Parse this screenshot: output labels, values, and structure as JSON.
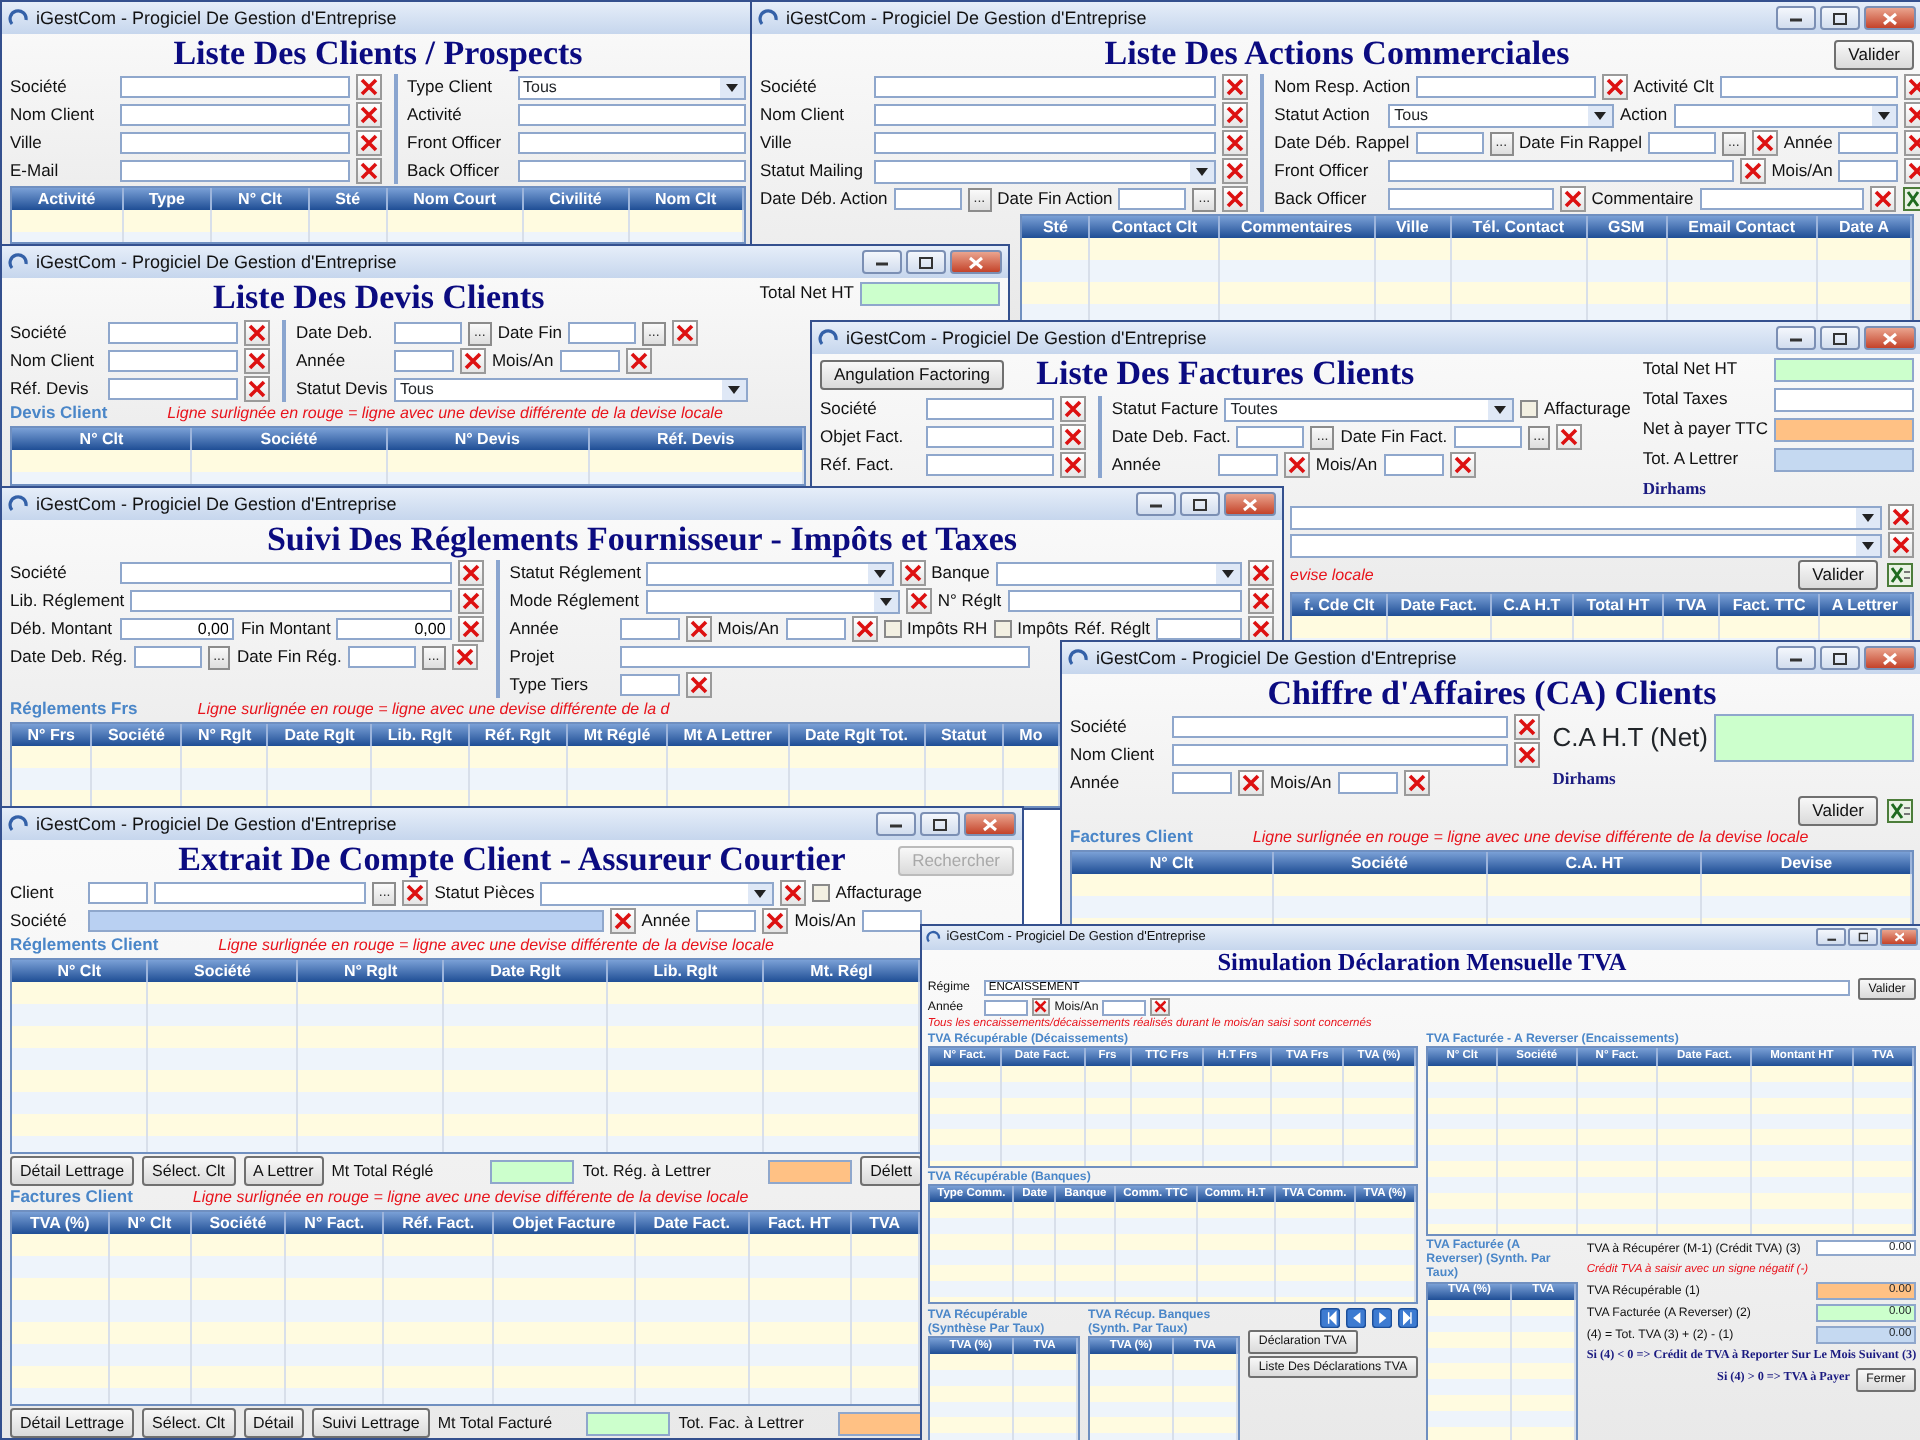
{
  "windows": [
    {
      "title": "iGestCom - Progiciel De Gestion d'Entreprise",
      "sections": [
        {
          "kind": "heading",
          "text": "Liste Des Clients / Prospects"
        },
        {
          "kind": "fields",
          "columns": [
            [
              [
                {
                  "kind": "text",
                  "label": "Société",
                  "clear": true
                }
              ],
              [
                {
                  "kind": "text",
                  "label": "Nom Client",
                  "clear": true
                }
              ],
              [
                {
                  "kind": "text",
                  "label": "Ville",
                  "clear": true
                }
              ],
              [
                {
                  "kind": "text",
                  "label": "E-Mail",
                  "clear": true
                }
              ]
            ],
            [
              [
                {
                  "kind": "combo",
                  "label": "Type Client",
                  "value": "Tous"
                }
              ],
              [
                {
                  "kind": "text",
                  "label": "Activité"
                }
              ],
              [
                {
                  "kind": "text",
                  "label": "Front Officer"
                }
              ],
              [
                {
                  "kind": "text",
                  "label": "Back Officer"
                }
              ]
            ]
          ]
        },
        {
          "kind": "grid",
          "columns": [
            "Activité",
            "Type",
            "N° Clt",
            "Sté",
            "Nom Court",
            "Civilité",
            "Nom Clt"
          ]
        }
      ]
    },
    {
      "title": "iGestCom - Progiciel De Gestion d'Entreprise",
      "sections": [
        {
          "kind": "heading",
          "text": "Liste Des Actions Commerciales",
          "end_button": {
            "kind": "button",
            "label": "Valider"
          }
        },
        {
          "kind": "fields",
          "columns": [
            [
              [
                {
                  "kind": "text",
                  "label": "Société",
                  "clear": true
                }
              ],
              [
                {
                  "kind": "text",
                  "label": "Nom Client",
                  "clear": true
                }
              ],
              [
                {
                  "kind": "text",
                  "label": "Ville",
                  "clear": true
                }
              ],
              [
                {
                  "kind": "combo",
                  "label": "Statut Mailing",
                  "clear": true
                }
              ],
              [
                {
                  "kind": "date",
                  "label": "Date Déb. Action",
                  "picker": "..."
                },
                {
                  "kind": "date",
                  "label": "Date Fin Action",
                  "picker": "...",
                  "clear": true
                }
              ]
            ],
            [
              [
                {
                  "kind": "text",
                  "label": "Nom Resp. Action",
                  "clear": true
                },
                {
                  "kind": "text",
                  "label": "Activité Clt",
                  "clear": true
                }
              ],
              [
                {
                  "kind": "combo",
                  "label": "Statut Action",
                  "value": "Tous"
                },
                {
                  "kind": "combo",
                  "label": "Action",
                  "clear": true
                }
              ],
              [
                {
                  "kind": "date",
                  "label": "Date Déb. Rappel",
                  "picker": "..."
                },
                {
                  "kind": "date",
                  "label": "Date Fin Rappel",
                  "picker": "...",
                  "clear": true
                },
                {
                  "kind": "short",
                  "label": "Année",
                  "clear": true
                }
              ],
              [
                {
                  "kind": "text",
                  "label": "Front Officer",
                  "clear": true
                },
                {
                  "kind": "short",
                  "label": "Mois/An",
                  "clear": true
                }
              ],
              [
                {
                  "kind": "text",
                  "label": "Back Officer",
                  "clear": true
                },
                {
                  "kind": "text",
                  "label": "Commentaire",
                  "clear": true
                },
                {
                  "kind": "export"
                }
              ]
            ]
          ]
        },
        {
          "kind": "grid",
          "columns": [
            "Sté",
            "Contact Clt",
            "Commentaires",
            "Ville",
            "Tél. Contact",
            "GSM",
            "Email Contact",
            "Date A"
          ]
        }
      ]
    },
    {
      "title": "iGestCom - Progiciel De Gestion d'Entreprise",
      "sections": [
        {
          "kind": "split",
          "parts": [
            [
              {
                "kind": "heading",
                "text": "Liste Des Devis Clients"
              },
              {
                "kind": "fields",
                "columns": [
                  [
                    [
                      {
                        "kind": "text",
                        "label": "Société",
                        "clear": true
                      }
                    ],
                    [
                      {
                        "kind": "text",
                        "label": "Nom Client",
                        "clear": true
                      }
                    ],
                    [
                      {
                        "kind": "text",
                        "label": "Réf. Devis",
                        "clear": true
                      }
                    ]
                  ],
                  [
                    [
                      {
                        "kind": "date",
                        "label": "Date Deb.",
                        "picker": "..."
                      },
                      {
                        "kind": "date",
                        "label": "Date Fin",
                        "picker": "...",
                        "clear": true
                      }
                    ],
                    [
                      {
                        "kind": "short",
                        "label": "Année",
                        "clear": true
                      },
                      {
                        "kind": "short",
                        "label": "Mois/An",
                        "clear": true
                      }
                    ],
                    [
                      {
                        "kind": "combo",
                        "label": "Statut Devis",
                        "value": "Tous"
                      }
                    ]
                  ]
                ]
              }
            ],
            [
              {
                "kind": "stack",
                "items": [
                  {
                    "kind": "total",
                    "label": "Total Net HT",
                    "color": "#ccffcc"
                  }
                ]
              }
            ]
          ]
        },
        {
          "kind": "caption",
          "caption": "Devis Client",
          "note": "Ligne surlignée en rouge = ligne avec une devise différente de la devise locale"
        },
        {
          "kind": "grid",
          "columns": [
            "N° Clt",
            "Société",
            "N° Devis",
            "Réf. Devis"
          ]
        }
      ]
    },
    {
      "title": "iGestCom - Progiciel De Gestion d'Entreprise",
      "sections": [
        {
          "kind": "split",
          "parts": [
            [
              {
                "kind": "heading",
                "text": "Liste Des Factures Clients",
                "lead_button": {
                  "kind": "button",
                  "label": "Angulation Factoring"
                }
              },
              {
                "kind": "fields",
                "columns": [
                  [
                    [
                      {
                        "kind": "text",
                        "label": "Société",
                        "clear": true
                      }
                    ],
                    [
                      {
                        "kind": "text",
                        "label": "Objet Fact.",
                        "clear": true
                      }
                    ],
                    [
                      {
                        "kind": "text",
                        "label": "Réf. Fact.",
                        "clear": true
                      }
                    ]
                  ],
                  [
                    [
                      {
                        "kind": "combo",
                        "label": "Statut Facture",
                        "value": "Toutes"
                      },
                      {
                        "kind": "check",
                        "label": "Affacturage",
                        "checked": false
                      }
                    ],
                    [
                      {
                        "kind": "date",
                        "label": "Date Deb. Fact.",
                        "picker": "..."
                      },
                      {
                        "kind": "date",
                        "label": "Date Fin Fact.",
                        "picker": "...",
                        "clear": true
                      }
                    ],
                    [
                      {
                        "kind": "short",
                        "label": "Année",
                        "clear": true
                      },
                      {
                        "kind": "short",
                        "label": "Mois/An",
                        "clear": true
                      }
                    ]
                  ]
                ]
              }
            ],
            [
              {
                "kind": "stack",
                "items": [
                  {
                    "kind": "total",
                    "label": "Total Net HT",
                    "color": "#ccffcc"
                  },
                  {
                    "kind": "total",
                    "label": "Total Taxes",
                    "color": "#ffffff"
                  },
                  {
                    "kind": "total",
                    "label": "Net à payer TTC",
                    "color": "#ffc184"
                  },
                  {
                    "kind": "total",
                    "label": "Tot. A Lettrer",
                    "color": "#c5d9f1"
                  },
                  {
                    "kind": "strong",
                    "text": "Dirhams"
                  }
                ]
              }
            ]
          ]
        },
        {
          "kind": "fields",
          "columns": [
            [
              [
                {
                  "kind": "combo",
                  "clear": true
                }
              ],
              [
                {
                  "kind": "combo",
                  "clear": true
                }
              ]
            ]
          ]
        },
        {
          "kind": "bar",
          "items": [
            {
              "kind": "note",
              "text": "evise locale"
            },
            {
              "kind": "button",
              "label": "Valider"
            },
            {
              "kind": "export"
            }
          ]
        },
        {
          "kind": "grid",
          "columns": [
            "f. Cde Clt",
            "Date Fact.",
            "C.A H.T",
            "Total HT",
            "TVA",
            "Fact. TTC",
            "A Lettrer"
          ]
        }
      ]
    },
    {
      "title": "iGestCom - Progiciel De Gestion d'Entreprise",
      "sections": [
        {
          "kind": "heading",
          "text": "Suivi Des Réglements Fournisseur - Impôts et Taxes"
        },
        {
          "kind": "fields",
          "columns": [
            [
              [
                {
                  "kind": "text",
                  "label": "Société",
                  "clear": true
                }
              ],
              [
                {
                  "kind": "text",
                  "label": "Lib. Réglement",
                  "clear": true
                }
              ],
              [
                {
                  "kind": "amount",
                  "label": "Déb. Montant",
                  "value": "0,00"
                },
                {
                  "kind": "amount",
                  "label": "Fin Montant",
                  "value": "0,00",
                  "clear": true
                }
              ],
              [
                {
                  "kind": "date",
                  "label": "Date Deb. Rég.",
                  "picker": "..."
                },
                {
                  "kind": "date",
                  "label": "Date Fin Rég.",
                  "picker": "...",
                  "clear": true
                }
              ]
            ],
            [
              [
                {
                  "kind": "combo",
                  "label": "Statut Réglement",
                  "clear": true
                },
                {
                  "kind": "combo",
                  "label": "Banque",
                  "clear": true
                }
              ],
              [
                {
                  "kind": "combo",
                  "label": "Mode Réglement",
                  "clear": true
                },
                {
                  "kind": "text",
                  "label": "N° Réglt",
                  "clear": true
                }
              ],
              [
                {
                  "kind": "short",
                  "label": "Année",
                  "clear": true
                },
                {
                  "kind": "short",
                  "label": "Mois/An",
                  "clear": true
                },
                {
                  "kind": "check",
                  "label": "Impôts RH",
                  "checked": false
                },
                {
                  "kind": "check",
                  "label": "Impôts",
                  "checked": false
                },
                {
                  "kind": "text",
                  "label": "Réf. Réglt",
                  "clear": true
                }
              ],
              [
                {
                  "kind": "text",
                  "label": "Projet"
                }
              ],
              [
                {
                  "kind": "short",
                  "label": "Type Tiers",
                  "clear": true
                }
              ]
            ]
          ]
        },
        {
          "kind": "caption",
          "caption": "Réglements Frs",
          "note": "Ligne surlignée en rouge = ligne avec une devise différente de la d"
        },
        {
          "kind": "grid",
          "columns": [
            "N° Frs",
            "Société",
            "N° Rglt",
            "Date Rglt",
            "Lib. Rglt",
            "Réf. Rglt",
            "Mt Réglé",
            "Mt A Lettrer",
            "Date Rglt Tot.",
            "Statut",
            "Mo"
          ]
        }
      ]
    },
    {
      "title": "iGestCom - Progiciel De Gestion d'Entreprise",
      "sections": [
        {
          "kind": "heading",
          "text": "Chiffre d'Affaires (CA) Clients"
        },
        {
          "kind": "split",
          "parts": [
            [
              {
                "kind": "fields",
                "columns": [
                  [
                    [
                      {
                        "kind": "text",
                        "label": "Société",
                        "clear": true
                      }
                    ],
                    [
                      {
                        "kind": "text",
                        "label": "Nom Client",
                        "clear": true
                      }
                    ],
                    [
                      {
                        "kind": "short",
                        "label": "Année",
                        "clear": true
                      },
                      {
                        "kind": "short",
                        "label": "Mois/An",
                        "clear": true
                      }
                    ]
                  ]
                ]
              }
            ],
            [
              {
                "kind": "stack",
                "items": [
                  {
                    "kind": "bigtotal",
                    "label": "C.A H.T (Net)",
                    "color": "#ccffcc"
                  },
                  {
                    "kind": "strong",
                    "text": "Dirhams"
                  },
                  {
                    "kind": "bar",
                    "items": [
                      {
                        "kind": "button",
                        "label": "Valider"
                      },
                      {
                        "kind": "export"
                      }
                    ]
                  }
                ]
              }
            ]
          ]
        },
        {
          "kind": "caption",
          "caption": "Factures Client",
          "note": "Ligne surlignée en rouge = ligne avec une devise différente de la devise locale"
        },
        {
          "kind": "grid",
          "columns": [
            "N° Clt",
            "Société",
            "C.A. HT",
            "Devise"
          ]
        }
      ]
    },
    {
      "title": "iGestCom - Progiciel De Gestion d'Entreprise",
      "sections": [
        {
          "kind": "heading",
          "text": "Extrait De Compte Client - Assureur Courtier",
          "end_button": {
            "kind": "button",
            "label": "Rechercher",
            "disabled": true
          }
        },
        {
          "kind": "fields",
          "columns": [
            [
              [
                {
                  "kind": "pair",
                  "label": "Client",
                  "picker": "...",
                  "clear": true
                },
                {
                  "kind": "combo",
                  "label": "Statut Pièces",
                  "clear": true
                },
                {
                  "kind": "check",
                  "label": "Affacturage",
                  "checked": false
                }
              ],
              [
                {
                  "kind": "text",
                  "label": "Société",
                  "readonly": true,
                  "clear": true
                },
                {
                  "kind": "short",
                  "label": "Année",
                  "clear": true
                },
                {
                  "kind": "short",
                  "label": "Mois/An"
                }
              ]
            ]
          ]
        },
        {
          "kind": "caption",
          "caption": "Réglements Client",
          "note": "Ligne surlignée en rouge = ligne avec une devise différente de la devise locale"
        },
        {
          "kind": "grid",
          "columns": [
            "N° Clt",
            "Société",
            "N° Rglt",
            "Date Rglt",
            "Lib. Rglt",
            "Mt. Régl"
          ]
        },
        {
          "kind": "bar",
          "items": [
            {
              "kind": "button",
              "label": "Détail Lettrage"
            },
            {
              "kind": "button",
              "label": "Sélect. Clt"
            },
            {
              "kind": "button",
              "label": "A Lettrer"
            },
            {
              "kind": "total",
              "label": "Mt Total Réglé",
              "color": "#ccffcc"
            },
            {
              "kind": "total",
              "label": "Tot. Rég. à Lettrer",
              "color": "#ffc184"
            },
            {
              "kind": "button",
              "label": "Délett"
            }
          ]
        },
        {
          "kind": "caption",
          "caption": "Factures Client",
          "note": "Ligne surlignée en rouge = ligne avec une devise différente de la devise locale"
        },
        {
          "kind": "grid",
          "columns": [
            "TVA (%)",
            "N° Clt",
            "Société",
            "N° Fact.",
            "Réf. Fact.",
            "Objet Facture",
            "Date Fact.",
            "Fact. HT",
            "TVA"
          ]
        },
        {
          "kind": "bar",
          "items": [
            {
              "kind": "button",
              "label": "Détail Lettrage"
            },
            {
              "kind": "button",
              "label": "Sélect. Clt"
            },
            {
              "kind": "button",
              "label": "Détail"
            },
            {
              "kind": "button",
              "label": "Suivi Lettrage"
            },
            {
              "kind": "total",
              "label": "Mt Total Facturé",
              "color": "#ccffcc"
            },
            {
              "kind": "total",
              "label": "Tot. Fac. à Lettrer",
              "color": "#ffc184"
            }
          ]
        }
      ]
    },
    {
      "title": "iGestCom - Progiciel De Gestion d'Entreprise",
      "sections": [
        {
          "kind": "heading",
          "text": "Simulation Déclaration Mensuelle TVA"
        },
        {
          "kind": "split",
          "parts": [
            [
              {
                "kind": "fields",
                "columns": [
                  [
                    [
                      {
                        "kind": "text",
                        "label": "Régime",
                        "value": "ENCAISSEMENT"
                      }
                    ],
                    [
                      {
                        "kind": "short",
                        "label": "Année",
                        "clear": true
                      },
                      {
                        "kind": "short",
                        "label": "Mois/An",
                        "clear": true
                      }
                    ]
                  ]
                ]
              }
            ],
            [
              {
                "kind": "bar",
                "items": [
                  {
                    "kind": "button",
                    "label": "Valider"
                  }
                ]
              }
            ]
          ]
        },
        {
          "kind": "note",
          "text": "Tous les encaissements/décaissements réalisés durant le mois/an saisi sont concernés"
        },
        {
          "kind": "split",
          "parts": [
            [
              {
                "kind": "grid",
                "caption": "TVA Récupérable (Décaissements)",
                "columns": [
                  "N° Fact.",
                  "Date Fact.",
                  "Frs",
                  "TTC Frs",
                  "H.T Frs",
                  "TVA Frs",
                  "TVA (%)"
                ]
              },
              {
                "kind": "grid",
                "caption": "TVA Récupérable (Banques)",
                "columns": [
                  "Type Comm.",
                  "Date",
                  "Banque",
                  "Comm. TTC",
                  "Comm. H.T",
                  "TVA Comm.",
                  "TVA (%)"
                ]
              },
              {
                "kind": "split",
                "parts": [
                  [
                    {
                      "kind": "grid",
                      "caption": "TVA Récupérable (Synthèse Par Taux)",
                      "columns": [
                        "TVA (%)",
                        "TVA"
                      ]
                    }
                  ],
                  [
                    {
                      "kind": "grid",
                      "caption": "TVA Récup. Banques (Synth. Par Taux)",
                      "columns": [
                        "TVA (%)",
                        "TVA"
                      ]
                    }
                  ],
                  [
                    {
                      "kind": "stack",
                      "items": [
                        {
                          "kind": "bar",
                          "items": [
                            {
                              "kind": "navfirst"
                            },
                            {
                              "kind": "navprev"
                            },
                            {
                              "kind": "navnext"
                            },
                            {
                              "kind": "navlast"
                            }
                          ]
                        },
                        {
                          "kind": "button",
                          "label": "Déclaration TVA"
                        },
                        {
                          "kind": "button",
                          "label": "Liste Des Déclarations TVA"
                        }
                      ]
                    }
                  ]
                ]
              }
            ],
            [
              {
                "kind": "grid",
                "caption": "TVA Facturée - A Reverser (Encaissements)",
                "columns": [
                  "N° Clt",
                  "Société",
                  "N° Fact.",
                  "Date Fact.",
                  "Montant HT",
                  "TVA"
                ]
              },
              {
                "kind": "split",
                "parts": [
                  [
                    {
                      "kind": "grid",
                      "caption": "TVA Facturée (A Reverser) (Synth. Par Taux)",
                      "columns": [
                        "TVA (%)",
                        "TVA"
                      ]
                    }
                  ],
                  [
                    {
                      "kind": "stack",
                      "items": [
                        {
                          "kind": "total",
                          "label": "TVA à Récupérer (M-1) (Crédit TVA) (3)",
                          "value": "0.00",
                          "color": "#ffffff"
                        },
                        {
                          "kind": "note",
                          "text": "Crédit TVA à saisir avec un signe négatif (-)"
                        },
                        {
                          "kind": "total",
                          "label": "TVA Récupérable (1)",
                          "value": "0.00",
                          "color": "#ffc184"
                        },
                        {
                          "kind": "total",
                          "label": "TVA Facturée (A Reverser) (2)",
                          "value": "0.00",
                          "color": "#ccffcc"
                        },
                        {
                          "kind": "total",
                          "label": "(4) = Tot. TVA (3) + (2) - (1)",
                          "value": "0.00",
                          "color": "#c5d9f1"
                        },
                        {
                          "kind": "strong",
                          "text": "Si (4) < 0 => Crédit de TVA à Reporter Sur Le Mois Suivant (3)"
                        },
                        {
                          "kind": "bar",
                          "items": [
                            {
                              "kind": "strong",
                              "text": "Si (4) > 0 => TVA à Payer"
                            },
                            {
                              "kind": "button",
                              "label": "Fermer"
                            }
                          ]
                        }
                      ]
                    }
                  ]
                ]
              }
            ]
          ]
        }
      ]
    }
  ]
}
